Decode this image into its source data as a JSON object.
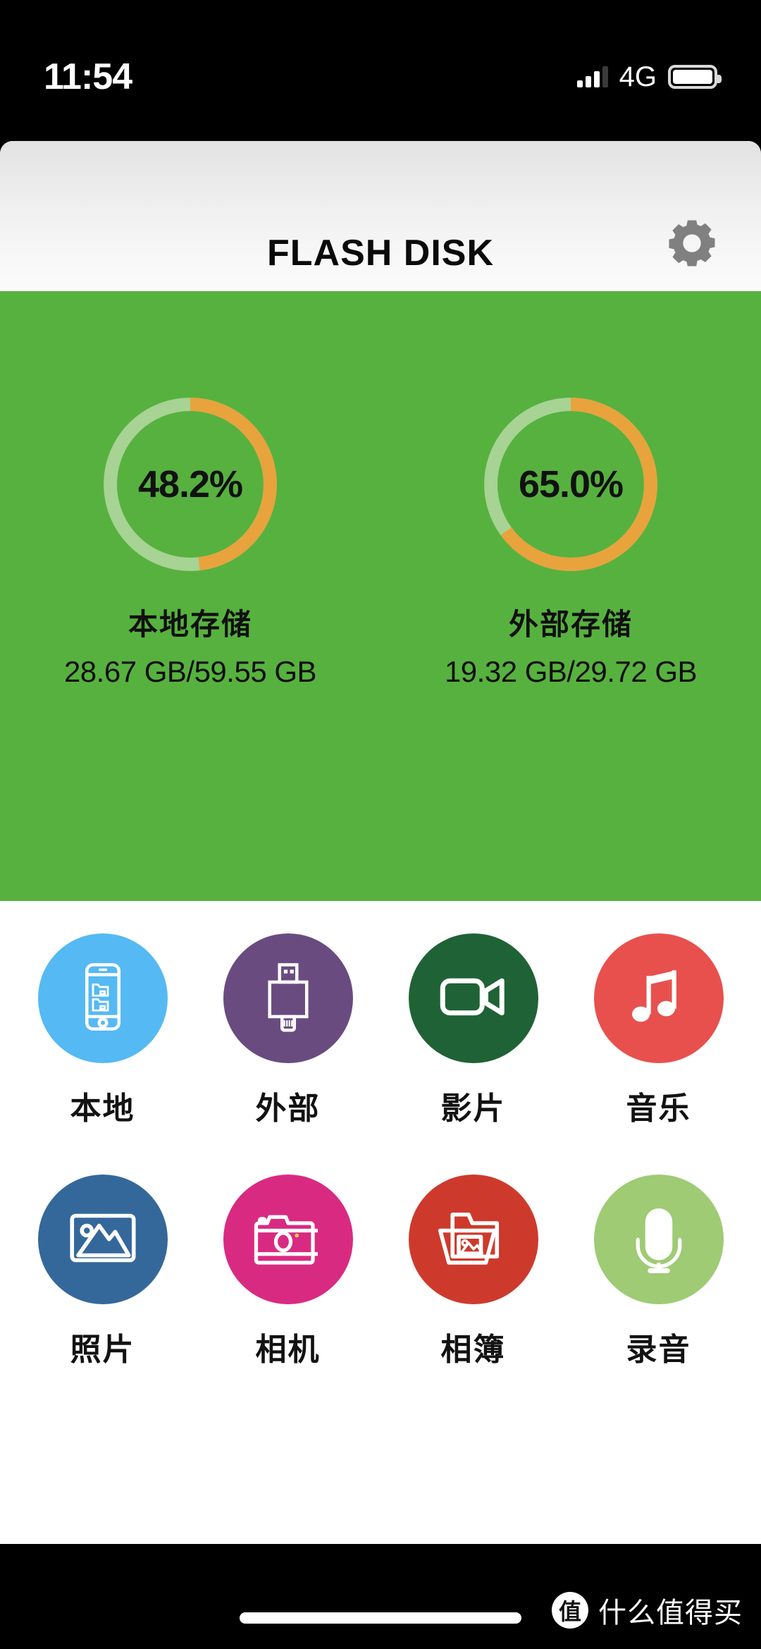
{
  "status_bar": {
    "time": "11:54",
    "network": "4G",
    "signal_icon": "signal-bars-icon",
    "battery_icon": "battery-full-icon"
  },
  "header": {
    "title": "FLASH DISK",
    "settings_icon": "gear-icon"
  },
  "storage": {
    "panel_color": "#57b13f",
    "used_arc_color": "#e8a33d",
    "track_color": "#a7d394",
    "cards": [
      {
        "percent_label": "48.2%",
        "percent_value": 48.2,
        "name": "本地存储",
        "size": "28.67 GB/59.55 GB",
        "used_gb": 28.67,
        "total_gb": 59.55
      },
      {
        "percent_label": "65.0%",
        "percent_value": 65.0,
        "name": "外部存储",
        "size": "19.32 GB/29.72 GB",
        "used_gb": 19.32,
        "total_gb": 29.72
      }
    ]
  },
  "grid": {
    "items": [
      {
        "label": "本地",
        "icon": "phone-storage-icon",
        "color": "#55b9f3"
      },
      {
        "label": "外部",
        "icon": "usb-drive-icon",
        "color": "#6a4b80"
      },
      {
        "label": "影片",
        "icon": "video-camera-icon",
        "color": "#1f6236"
      },
      {
        "label": "音乐",
        "icon": "music-note-icon",
        "color": "#e8504d"
      },
      {
        "label": "照片",
        "icon": "photo-image-icon",
        "color": "#34689b"
      },
      {
        "label": "相机",
        "icon": "camera-icon",
        "color": "#d92a82"
      },
      {
        "label": "相簿",
        "icon": "photo-album-icon",
        "color": "#cd3a2c"
      },
      {
        "label": "录音",
        "icon": "microphone-icon",
        "color": "#9ecb74"
      }
    ]
  },
  "bottom": {
    "watermark_badge": "值",
    "watermark_text": "什么值得买",
    "home_indicator": "home-indicator"
  }
}
